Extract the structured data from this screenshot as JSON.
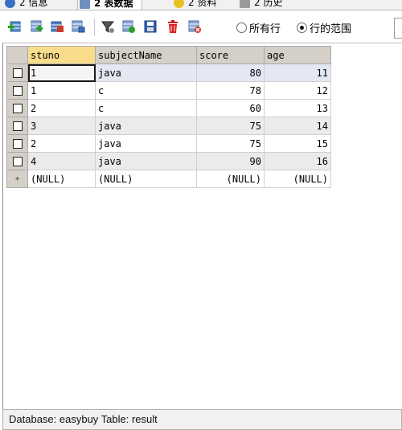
{
  "tabs": [
    {
      "label": "2 信息",
      "icon": "info-icon"
    },
    {
      "label": "2 表数据",
      "icon": "table-icon"
    },
    {
      "label": "2 资料",
      "icon": "profile-icon"
    },
    {
      "label": "2 历史",
      "icon": "history-icon"
    }
  ],
  "toolbar": {
    "icons": [
      "insert-row-icon",
      "duplicate-row-icon",
      "save-rows-icon",
      "export-icon",
      "filter-icon",
      "add-filter-icon",
      "save-icon",
      "delete-icon",
      "cancel-icon"
    ],
    "radio_all_rows": "所有行",
    "radio_row_range": "行的范围",
    "selected_radio": "行的范围"
  },
  "grid": {
    "columns": [
      "stuno",
      "subjectName",
      "score",
      "age"
    ],
    "sorted_column": "stuno",
    "rows": [
      {
        "stuno": "1",
        "subjectName": "java",
        "score": "80",
        "age": "11"
      },
      {
        "stuno": "1",
        "subjectName": "c",
        "score": "78",
        "age": "12"
      },
      {
        "stuno": "2",
        "subjectName": "c",
        "score": "60",
        "age": "13"
      },
      {
        "stuno": "3",
        "subjectName": "java",
        "score": "75",
        "age": "14"
      },
      {
        "stuno": "2",
        "subjectName": "java",
        "score": "75",
        "age": "15"
      },
      {
        "stuno": "4",
        "subjectName": "java",
        "score": "90",
        "age": "16"
      }
    ],
    "new_row": {
      "marker": "*",
      "stuno": "(NULL)",
      "subjectName": "(NULL)",
      "score": "(NULL)",
      "age": "(NULL)"
    }
  },
  "status": {
    "text": "Database: easybuy Table: result"
  }
}
